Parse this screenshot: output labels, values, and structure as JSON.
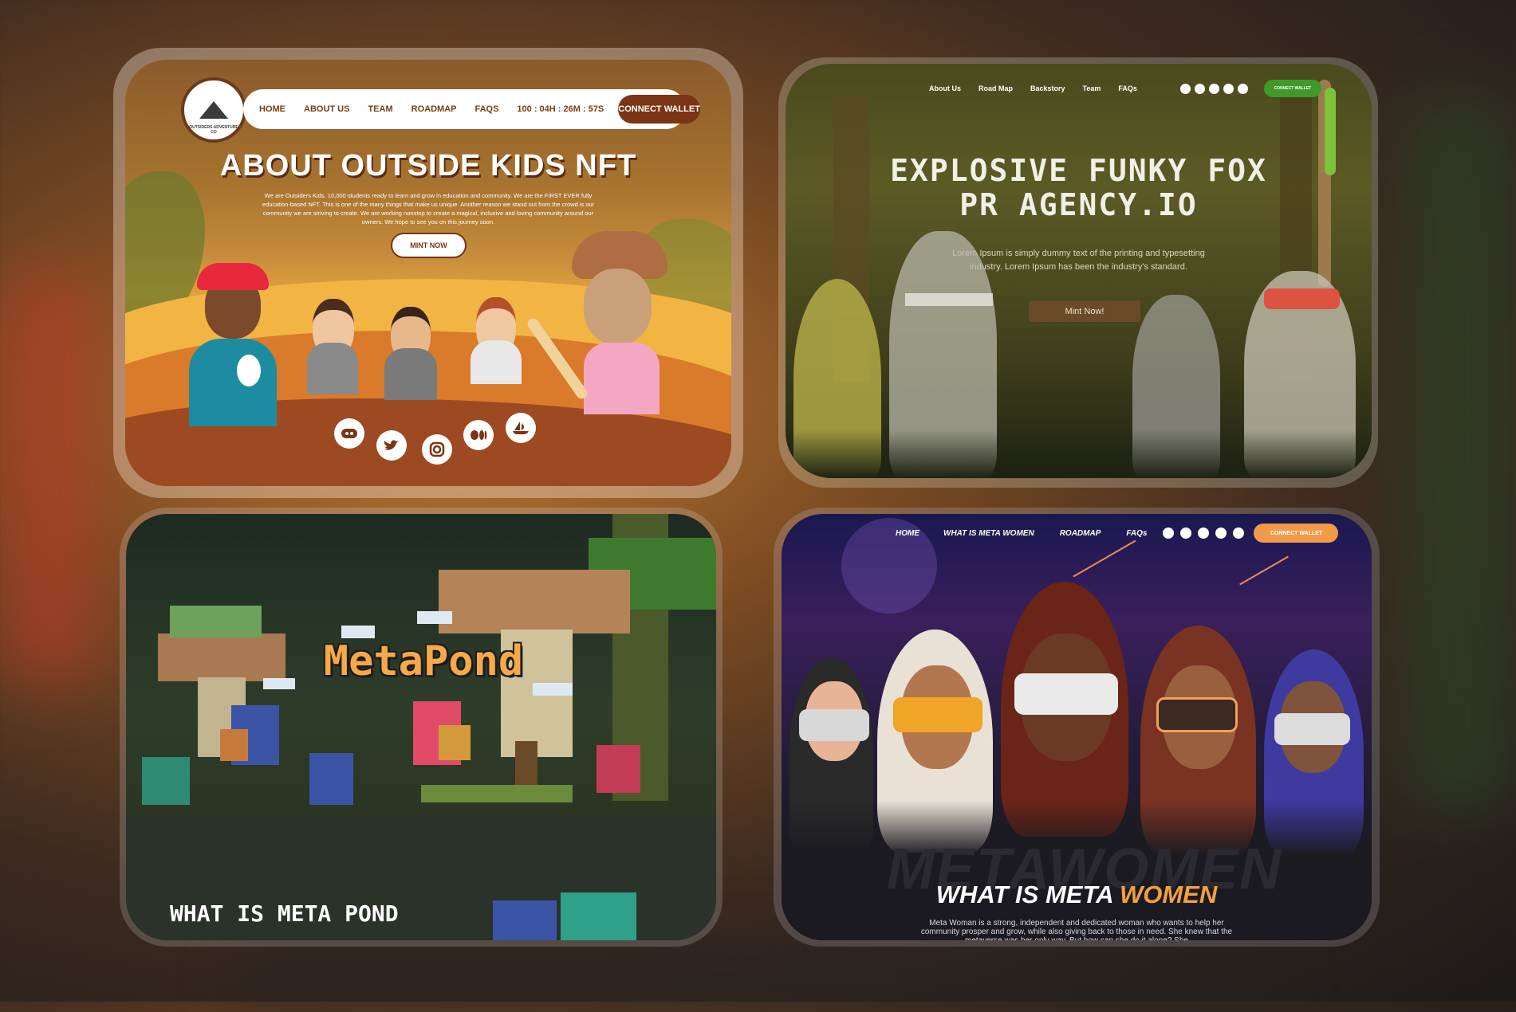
{
  "card1": {
    "logo_text": "OUTSIDERS ADVENTURE CO",
    "nav": [
      "HOME",
      "ABOUT US",
      "TEAM",
      "ROADMAP",
      "FAQS",
      "100 : 04H : 26M : 57S"
    ],
    "connect": "CONNECT WALLET",
    "title": "ABOUT OUTSIDE KIDS NFT",
    "body": "We are Outsiders Kids. 10,000 students ready to learn and grow in education and community. We are the FIRST EVER fully education-based NFT. This is one of the many things that make us unique. Another reason we stand out from the crowd is our community we are striving to create. We are working nonstop to create a magical, inclusive and loving community around our owners. We hope to see you on this journey soon.",
    "cta": "MINT NOW",
    "socials": [
      "discord-icon",
      "twitter-icon",
      "instagram-icon",
      "medium-icon",
      "opensea-icon"
    ]
  },
  "card2": {
    "nav": [
      "About Us",
      "Road Map",
      "Backstory",
      "Team",
      "FAQs"
    ],
    "connect": "CONNECT WALLET",
    "title_line1": "EXPLOSIVE FUNKY FOX",
    "title_line2": "PR AGENCY.IO",
    "body": "Lorem Ipsum is simply dummy text of the printing and typesetting industry. Lorem Ipsum has been the industry's standard.",
    "cta": "Mint Now!"
  },
  "card3": {
    "logo": "MetaPond",
    "heading": "WHAT IS META POND"
  },
  "card4": {
    "nav": [
      "HOME",
      "WHAT IS META WOMEN",
      "ROADMAP",
      "FAQs"
    ],
    "connect": "CONNECT WALLET",
    "watermark": "METAWOMEN",
    "heading_a": "WHAT IS META",
    "heading_b": "WOMEN",
    "body": "Meta Woman is a strong, independent and dedicated woman who wants to help her community prosper and grow, while also giving back to those in need. She knew that the metaverse was her only way. But how can she do it alone? She"
  }
}
